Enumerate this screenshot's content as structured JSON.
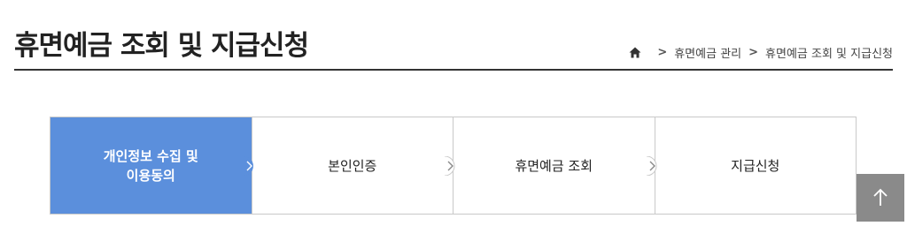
{
  "header": {
    "title": "휴면예금 조회 및 지급신청",
    "breadcrumb": {
      "home_icon": "home-icon",
      "separator": ">",
      "items": [
        "휴면예금 관리",
        "휴면예금 조회 및 지급신청"
      ]
    }
  },
  "steps": {
    "items": [
      {
        "label": "개인정보 수집 및\n이용동의",
        "active": true
      },
      {
        "label": "본인인증",
        "active": false
      },
      {
        "label": "휴면예금 조회",
        "active": false
      },
      {
        "label": "지급신청",
        "active": false
      }
    ],
    "chevron_icon": "chevron-right-icon"
  },
  "scroll_top": {
    "icon": "arrow-up-icon"
  },
  "colors": {
    "active_step": "#5b8fdc",
    "border": "#c9c9c9",
    "top_button": "#8a8a8a",
    "header_rule": "#333333"
  }
}
